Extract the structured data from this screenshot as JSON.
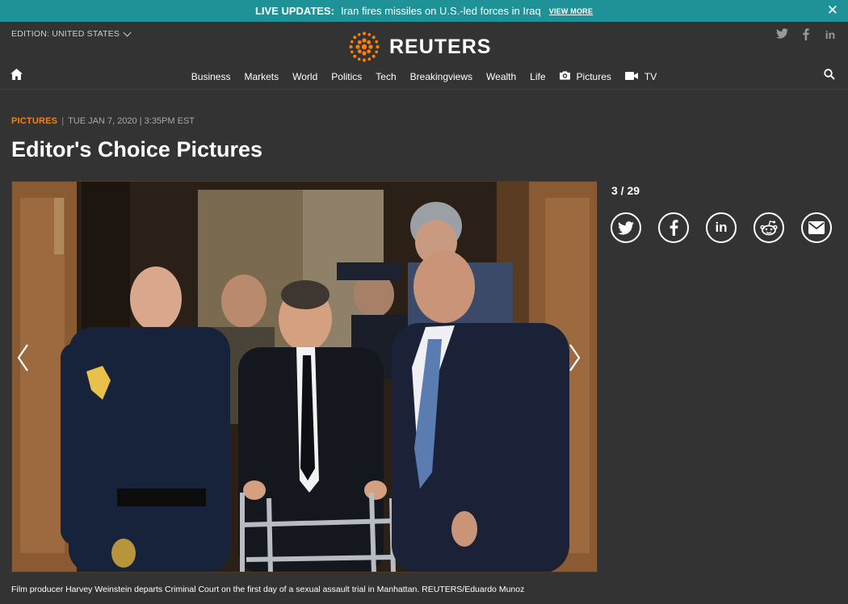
{
  "banner": {
    "label": "LIVE UPDATES:",
    "headline": "Iran fires missiles on U.S.-led forces in Iraq",
    "view_more": "VIEW MORE",
    "close": "✕"
  },
  "header": {
    "edition": "EDITION: UNITED STATES",
    "brand": "REUTERS",
    "social": [
      "twitter-icon",
      "facebook-icon",
      "linkedin-icon"
    ]
  },
  "nav": {
    "items": [
      "Business",
      "Markets",
      "World",
      "Politics",
      "Tech",
      "Breakingviews",
      "Wealth",
      "Life",
      "Pictures",
      "TV"
    ]
  },
  "article": {
    "section": "PICTURES",
    "date": "TUE JAN 7, 2020 | 3:35PM EST",
    "title": "Editor's Choice Pictures",
    "counter": "3 / 29",
    "caption": "Film producer Harvey Weinstein departs Criminal Court on the first day of a sexual assault trial in Manhattan. REUTERS/Eduardo Munoz"
  },
  "share": [
    "twitter-icon",
    "facebook-icon",
    "linkedin-icon",
    "reddit-icon",
    "email-icon"
  ],
  "colors": {
    "banner": "#1f9297",
    "background": "#333333",
    "accent": "#ff8000"
  }
}
